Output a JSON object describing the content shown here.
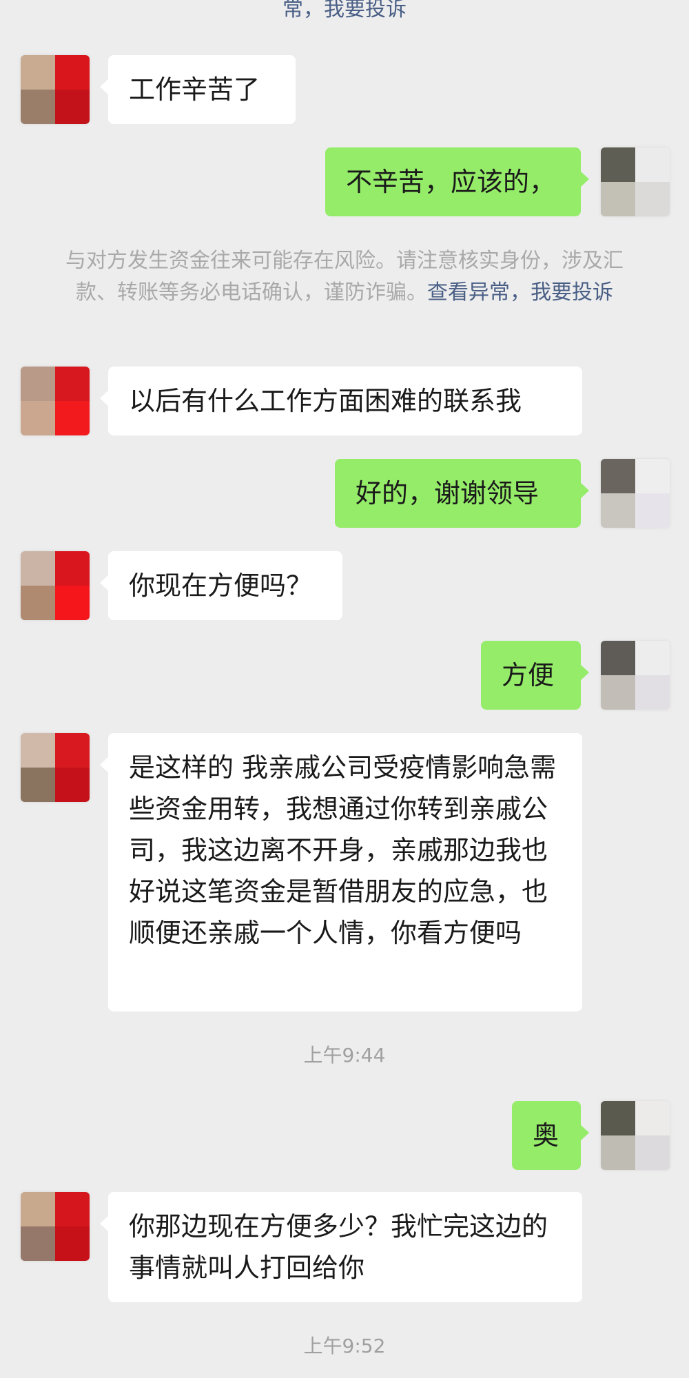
{
  "top_notice": {
    "text": "常，我要投诉"
  },
  "risk_notice": {
    "text": "与对方发生资金往来可能存在风险。请注意核实身份，涉及汇款、转账等务必电话确认，谨防诈骗。",
    "link_view": "查看异常",
    "sep": "，",
    "link_report": "我要投诉"
  },
  "messages": [
    {
      "side": "in",
      "text": "工作辛苦了"
    },
    {
      "side": "out",
      "text": "不辛苦，应该的，"
    },
    {
      "side": "in",
      "text": "以后有什么工作方面困难的联系我"
    },
    {
      "side": "out",
      "text": "好的，谢谢领导"
    },
    {
      "side": "in",
      "text": "你现在方便吗？"
    },
    {
      "side": "out",
      "text": "方便"
    },
    {
      "side": "in",
      "text": "是这样的 我亲戚公司受疫情影响急需些资金用转，我想通过你转到亲戚公司，我这边离不开身，亲戚那边我也好说这笔资金是暂借朋友的应急，也顺便还亲戚一个人情，你看方便吗"
    },
    {
      "side": "out",
      "text": "奥"
    },
    {
      "side": "in",
      "text": "你那边现在方便多少？我忙完这边的事情就叫人打回给你"
    }
  ],
  "times": [
    "上午9:44",
    "上午9:52"
  ],
  "colors": {
    "background": "#ededed",
    "bubble_in": "#ffffff",
    "bubble_out": "#95ec69",
    "link": "#4a5f86"
  }
}
